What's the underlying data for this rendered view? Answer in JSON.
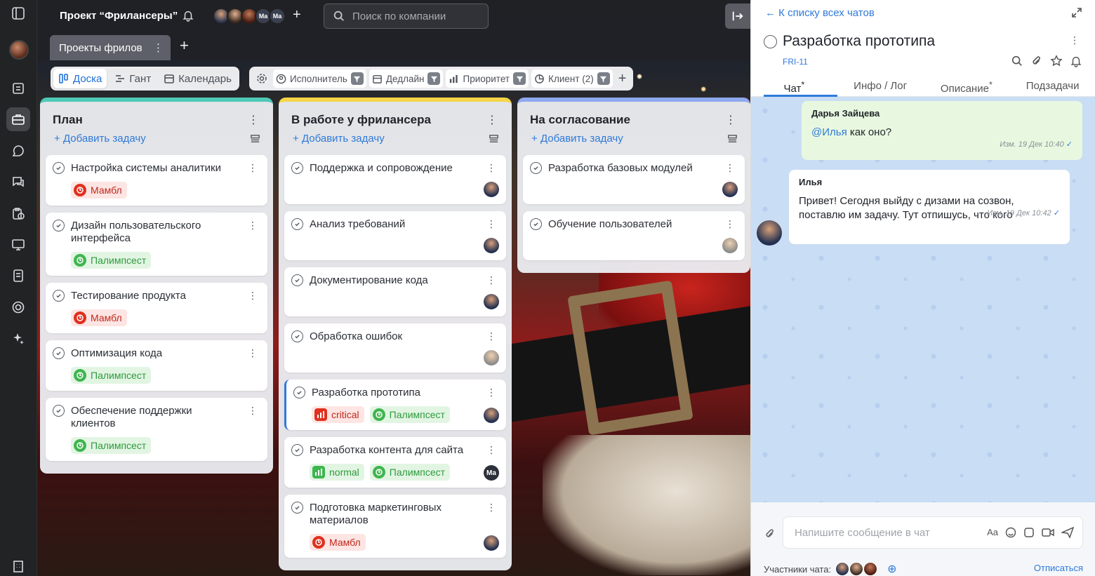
{
  "topbar": {
    "project_title": "Проект “Фрилансеры”",
    "avatar_initials": [
      "Ma",
      "Ma"
    ],
    "search_placeholder": "Поиск по компании"
  },
  "tab": {
    "label": "Проекты фрилов"
  },
  "views": [
    "Доска",
    "Гант",
    "Календарь"
  ],
  "filters": [
    "Исполнитель",
    "Дедлайн",
    "Приоритет",
    "Клиент (2)"
  ],
  "columns": [
    {
      "title": "План",
      "add_label": "Добавить задачу",
      "accent": "#4ec9b7",
      "cards": [
        {
          "title": "Настройка системы аналитики",
          "tags": [
            {
              "label": "Мамбл",
              "kind": "red"
            }
          ]
        },
        {
          "title": "Дизайн пользовательского интерфейса",
          "tags": [
            {
              "label": "Палимпсест",
              "kind": "green"
            }
          ]
        },
        {
          "title": "Тестирование продукта",
          "tags": [
            {
              "label": "Мамбл",
              "kind": "red"
            }
          ]
        },
        {
          "title": "Оптимизация кода",
          "tags": [
            {
              "label": "Палимпсест",
              "kind": "green"
            }
          ]
        },
        {
          "title": "Обеспечение поддержки клиентов",
          "tags": [
            {
              "label": "Палимпсест",
              "kind": "green"
            }
          ]
        }
      ]
    },
    {
      "title": "В работе у фрилансера",
      "add_label": "Добавить задачу",
      "accent": "#f5d547",
      "cards": [
        {
          "title": "Поддержка и сопровождение",
          "tags": [],
          "assignee": "p1"
        },
        {
          "title": "Анализ требований",
          "tags": [],
          "assignee": "p1"
        },
        {
          "title": "Документирование кода",
          "tags": [],
          "assignee": "p1"
        },
        {
          "title": "Обработка ошибок",
          "tags": [],
          "assignee": "p2"
        },
        {
          "title": "Разработка прототипа",
          "tags": [
            {
              "label": "critical",
              "kind": "crit"
            },
            {
              "label": "Палимпсест",
              "kind": "green"
            }
          ],
          "assignee": "p1",
          "selected": true
        },
        {
          "title": "Разработка контента для сайта",
          "tags": [
            {
              "label": "normal",
              "kind": "norm"
            },
            {
              "label": "Палимпсест",
              "kind": "green"
            }
          ],
          "assignee": "ma",
          "assignee_text": "Ma"
        },
        {
          "title": "Подготовка маркетинговых материалов",
          "tags": [
            {
              "label": "Мамбл",
              "kind": "red"
            }
          ],
          "assignee": "p1"
        }
      ]
    },
    {
      "title": "На согласование",
      "add_label": "Добавить задачу",
      "accent": "#8fa8f0",
      "cards": [
        {
          "title": "Разработка базовых модулей",
          "tags": [],
          "assignee": "p1"
        },
        {
          "title": "Обучение пользователей",
          "tags": [],
          "assignee": "p2"
        }
      ]
    }
  ],
  "panel": {
    "back_label": "К списку всех чатов",
    "title": "Разработка прототипа",
    "task_id": "FRI-11",
    "tabs": [
      "Чат",
      "Инфо / Лог",
      "Описание",
      "Подзадачи"
    ],
    "messages": [
      {
        "author": "Дарья Зайцева",
        "mention": "@Илья",
        "text": " как оно?",
        "meta": "Изм. 19 Дек 10:40"
      },
      {
        "author": "Илья",
        "text": "Привет! Сегодня выйду с дизами на созвон, поставлю им задачу. Тут отпишусь, что кого",
        "meta": "Изм. 19 Дек 10:42"
      }
    ],
    "composer_placeholder": "Напишите сообщение в чат",
    "members_label": "Участники чата:",
    "leave_label": "Отписаться"
  },
  "icons": {
    "rail": [
      "sidebar-toggle-icon",
      "tasks-icon",
      "briefcase-icon",
      "chat-icon",
      "messages-icon",
      "calendar-clipboard-icon",
      "monitor-icon",
      "document-icon",
      "support-icon",
      "ai-sparkle-icon",
      "building-icon"
    ]
  }
}
